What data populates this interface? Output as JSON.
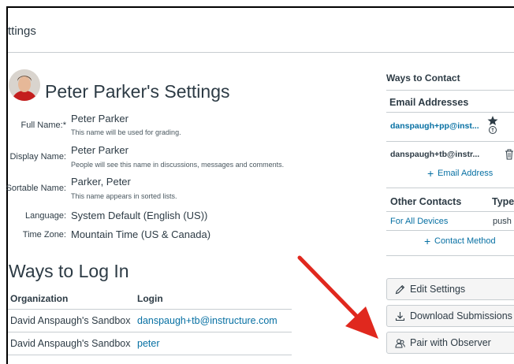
{
  "header": {
    "breadcrumb": "ttings"
  },
  "profile": {
    "title": "Peter Parker's Settings",
    "fields": [
      {
        "label": "Full Name:*",
        "value": "Peter Parker",
        "hint": "This name will be used for grading."
      },
      {
        "label": "Display Name:",
        "value": "Peter Parker",
        "hint": "People will see this name in discussions, messages and comments."
      },
      {
        "label": "Sortable Name:",
        "value": "Parker, Peter",
        "hint": "This name appears in sorted lists."
      },
      {
        "label": "Language:",
        "value": "System Default (English (US))"
      },
      {
        "label": "Time Zone:",
        "value": "Mountain Time (US & Canada)"
      }
    ]
  },
  "logins": {
    "title": "Ways to Log In",
    "headers": {
      "org": "Organization",
      "login": "Login"
    },
    "rows": [
      {
        "org": "David Anspaugh's Sandbox",
        "login": "danspaugh+tb@instructure.com"
      },
      {
        "org": "David Anspaugh's Sandbox",
        "login": "peter"
      }
    ]
  },
  "contact": {
    "title": "Ways to Contact",
    "email_header": "Email Addresses",
    "emails": [
      {
        "address": "danspaugh+pp@inst...",
        "icon": "star-icon"
      },
      {
        "address": "danspaugh+tb@instr...",
        "icon": "trash-icon"
      }
    ],
    "add_email": "Email Address",
    "other_header": "Other Contacts",
    "type_header": "Type",
    "others": [
      {
        "name": "For All Devices",
        "type": "push"
      }
    ],
    "add_contact": "Contact Method"
  },
  "actions": {
    "edit": "Edit Settings",
    "download": "Download Submissions",
    "pair": "Pair with Observer"
  },
  "colors": {
    "link": "#0770a3",
    "arrow": "#e0281e",
    "text": "#2d3b45"
  }
}
